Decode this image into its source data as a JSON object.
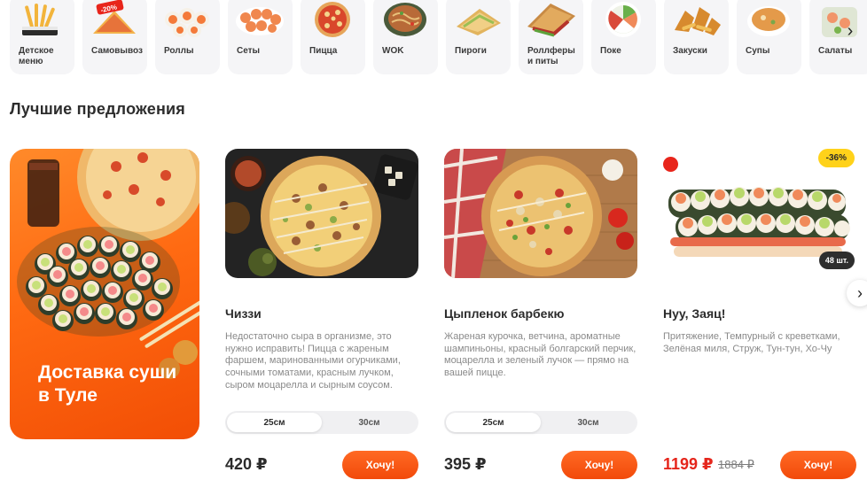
{
  "categories": [
    {
      "label": "Детское меню",
      "icon": "kids-menu-icon"
    },
    {
      "label": "Самовывоз",
      "icon": "pickup-discount-icon",
      "promo": "-20%"
    },
    {
      "label": "Роллы",
      "icon": "rolls-icon"
    },
    {
      "label": "Сеты",
      "icon": "sets-icon"
    },
    {
      "label": "Пицца",
      "icon": "pizza-icon"
    },
    {
      "label": "WOK",
      "icon": "wok-icon"
    },
    {
      "label": "Пироги",
      "icon": "pies-icon"
    },
    {
      "label": "Роллферы и питы",
      "icon": "pita-icon"
    },
    {
      "label": "Поке",
      "icon": "poke-icon"
    },
    {
      "label": "Закуски",
      "icon": "snacks-icon"
    },
    {
      "label": "Супы",
      "icon": "soup-icon"
    },
    {
      "label": "Салаты",
      "icon": "salad-icon"
    }
  ],
  "section": {
    "title": "Лучшие предложения"
  },
  "promo": {
    "title": "Доставка суши в Туле"
  },
  "products": [
    {
      "name": "Чиззи",
      "description": "Недостаточно сыра в организме, это нужно исправить! Пицца с жареным фаршем, маринованными огурчиками, сочными томатами, красным лучком, сыром моцарелла и сырным соусом.",
      "sizes": [
        "25см",
        "30см"
      ],
      "selected_size": "25см",
      "price": "420 ₽",
      "button": "Хочу!"
    },
    {
      "name": "Цыпленок барбекю",
      "description": "Жареная курочка, ветчина, ароматные шампиньоны, красный болгарский перчик, моцарелла и зеленый лучок — прямо на вашей пицце.",
      "sizes": [
        "25см",
        "30см"
      ],
      "selected_size": "25см",
      "price": "395 ₽",
      "button": "Хочу!"
    },
    {
      "name": "Нуу, Заяц!",
      "description": "Притяжение, Темпурный с креветками, Зелёная миля, Струж, Тун-тун, Хо-Чу",
      "price": "1199 ₽",
      "old_price": "1884 ₽",
      "discount": "-36%",
      "pieces": "48 шт.",
      "button": "Хочу!"
    }
  ],
  "colors": {
    "accent": "#f24a0a",
    "sale": "#e5251b",
    "badge": "#ffd21a"
  }
}
